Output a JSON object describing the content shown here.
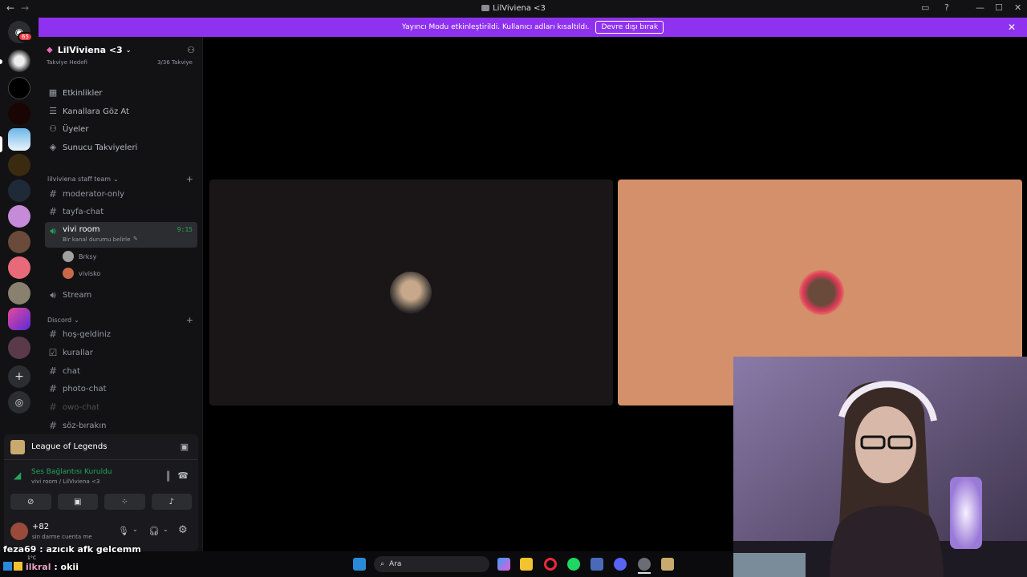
{
  "titlebar": {
    "title": "LilViviena <3",
    "back": "←",
    "forward": "→"
  },
  "window_controls": [
    "—",
    "☐",
    "✕"
  ],
  "banner": {
    "text": "Yayıncı Modu etkinleştirildi. Kullanıcı adları kısaltıldı.",
    "button": "Devre dışı bırak"
  },
  "rail": {
    "home_badge": "65"
  },
  "server": {
    "name": "LilViviena <3",
    "boost_label": "Takviye Hedefi",
    "boost_progress": "3/36 Takviye",
    "nav": [
      {
        "label": "Etkinlikler",
        "icon": "calendar-icon"
      },
      {
        "label": "Kanallara Göz At",
        "icon": "browse-icon"
      },
      {
        "label": "Üyeler",
        "icon": "members-icon"
      },
      {
        "label": "Sunucu Takviyeleri",
        "icon": "boost-icon"
      }
    ],
    "categories": [
      {
        "name": "lilviviena staff team",
        "channels": [
          {
            "name": "moderator-only",
            "type": "text"
          },
          {
            "name": "tayfa-chat",
            "type": "text"
          },
          {
            "name": "vivi room",
            "type": "voice",
            "timer": "9:15",
            "status": "Bir kanal durumu belirle"
          },
          {
            "name": "Stream",
            "type": "voice"
          }
        ],
        "voice_users": [
          "Brksy",
          "vivisko"
        ]
      },
      {
        "name": "Discord",
        "channels": [
          {
            "name": "hoş-geldiniz",
            "type": "text"
          },
          {
            "name": "kurallar",
            "type": "rules"
          },
          {
            "name": "chat",
            "type": "text"
          },
          {
            "name": "photo-chat",
            "type": "text"
          },
          {
            "name": "owo-chat",
            "type": "text"
          },
          {
            "name": "söz-bırakın",
            "type": "text"
          }
        ]
      }
    ]
  },
  "activity": {
    "game": "League of Legends"
  },
  "voice_connection": {
    "status": "Ses Bağlantısı Kuruldu",
    "location": "vivi room / LilViviena <3"
  },
  "user": {
    "name": "+82",
    "status": "sin darme cuenta me"
  },
  "taskbar": {
    "search": "Ara",
    "weather_temp": "1°C"
  },
  "stream_chat": [
    {
      "user": "feza69",
      "message": "azıcık afk gelcemm"
    },
    {
      "user": "ilkral",
      "message": "okii"
    }
  ]
}
